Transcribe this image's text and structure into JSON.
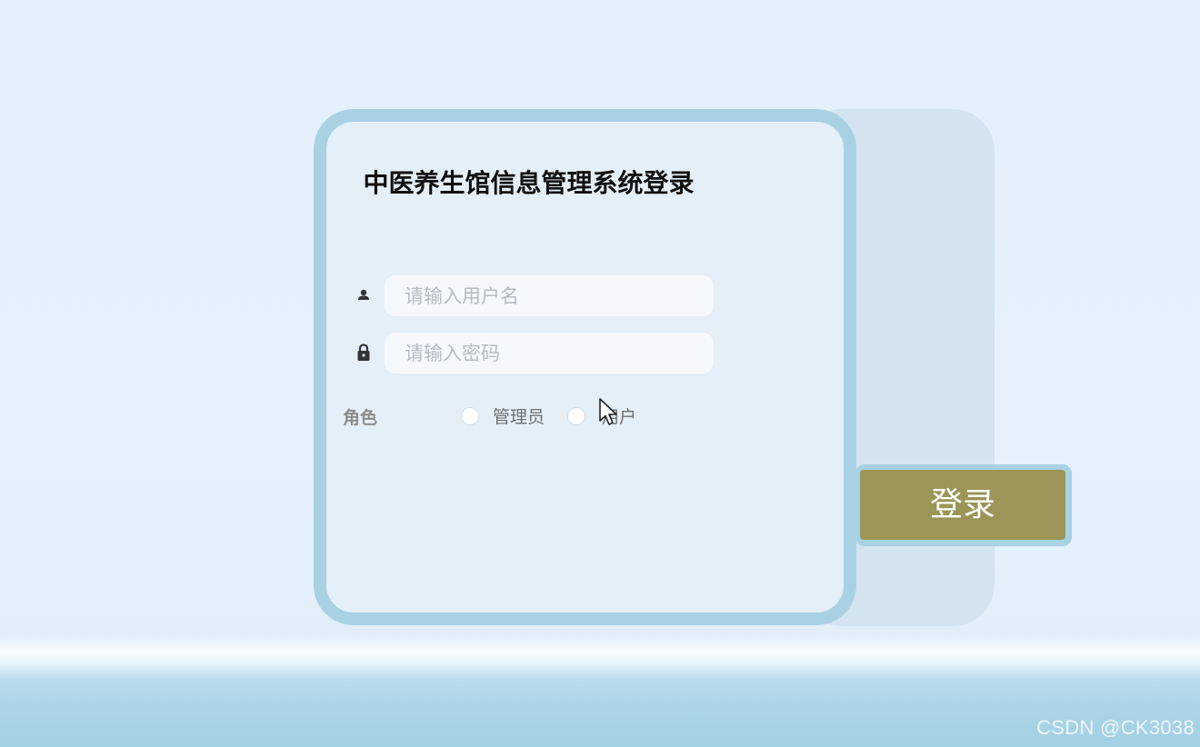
{
  "login": {
    "title": "中医养生馆信息管理系统登录",
    "username": {
      "icon": "user-icon",
      "placeholder": "请输入用户名",
      "value": ""
    },
    "password": {
      "icon": "lock-icon",
      "placeholder": "请输入密码",
      "value": ""
    },
    "role": {
      "label": "角色",
      "options": [
        {
          "label": "管理员",
          "checked": false
        },
        {
          "label": "用户",
          "checked": false
        }
      ]
    },
    "submit_label": "登录"
  },
  "colors": {
    "card_border": "#a8d2e4",
    "card_bg": "#e4eff8",
    "button_bg": "#9b9557",
    "button_text": "#ffffff"
  },
  "watermark": "CSDN @CK3038"
}
